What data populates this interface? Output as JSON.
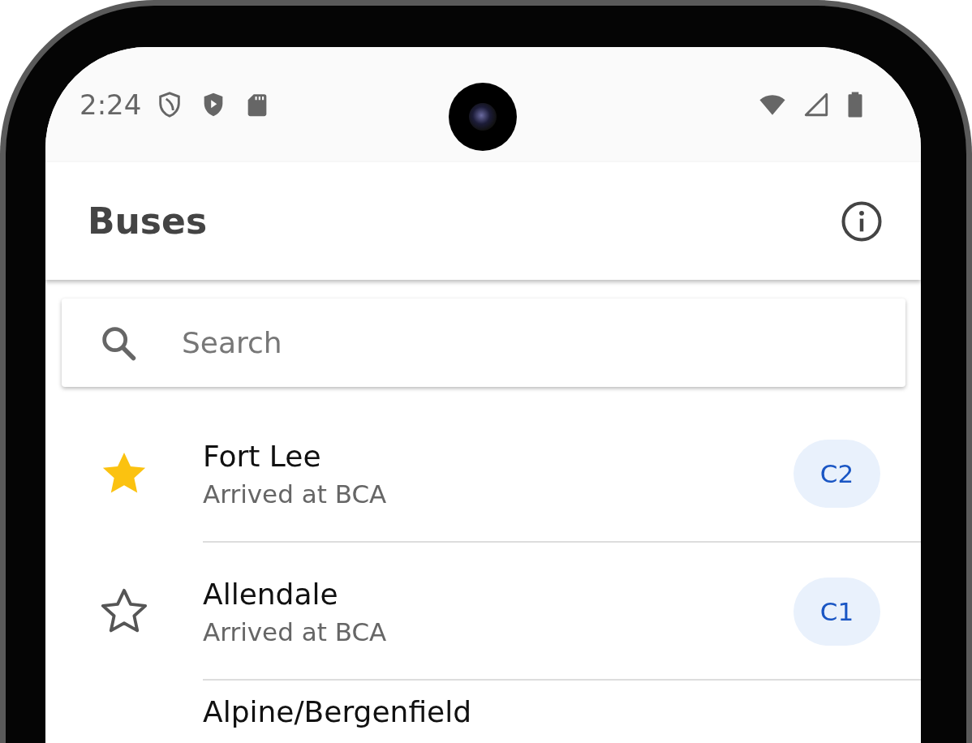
{
  "status_bar": {
    "time": "2:24"
  },
  "app_bar": {
    "title": "Buses"
  },
  "search": {
    "placeholder": "Search"
  },
  "rows": [
    {
      "favorite": true,
      "title": "Fort Lee",
      "subtitle": "Arrived at BCA",
      "route": "C2"
    },
    {
      "favorite": false,
      "title": "Allendale",
      "subtitle": "Arrived at BCA",
      "route": "C1"
    },
    {
      "title": "Alpine/Bergenfield"
    }
  ]
}
